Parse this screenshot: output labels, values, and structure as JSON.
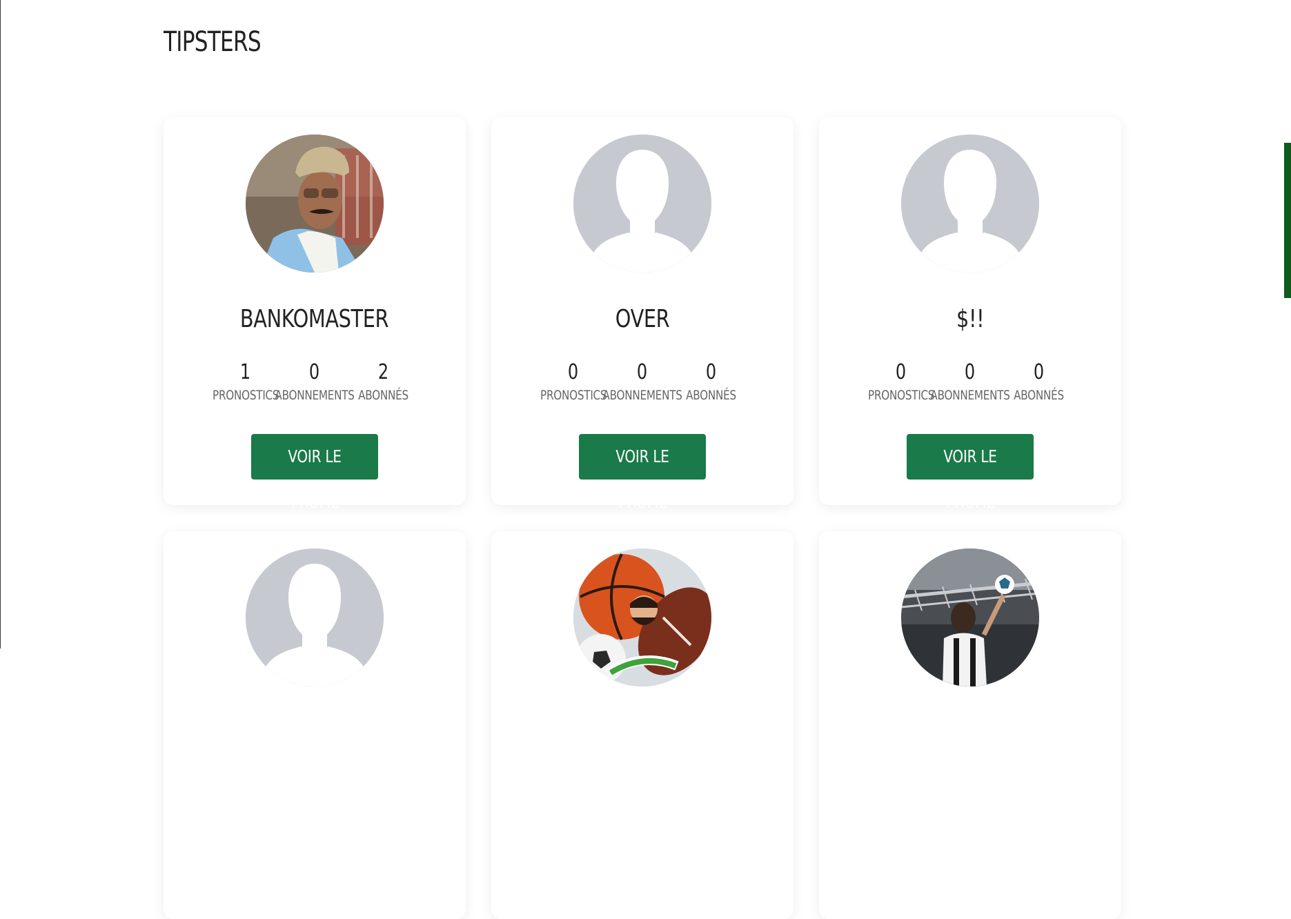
{
  "page": {
    "title": "TIPSTERS"
  },
  "colors": {
    "accent": "#1a7a49",
    "side_accent": "#0f5a1e",
    "avatar_placeholder": "#c6cad0"
  },
  "tipsters": [
    {
      "name": "BANKOMASTER",
      "avatar": "photo-man-cap-sunglasses",
      "stats": [
        {
          "value": "1",
          "label": "PRONOSTICS"
        },
        {
          "value": "0",
          "label": "ABONNEMENTS"
        },
        {
          "value": "2",
          "label": "ABONNÉS"
        }
      ],
      "button": "VOIR LE PROFIL"
    },
    {
      "name": "OVER",
      "avatar": "default-user-silhouette",
      "stats": [
        {
          "value": "0",
          "label": "PRONOSTICS"
        },
        {
          "value": "0",
          "label": "ABONNEMENTS"
        },
        {
          "value": "0",
          "label": "ABONNÉS"
        }
      ],
      "button": "VOIR LE PROFIL"
    },
    {
      "name": "$!!",
      "avatar": "default-user-silhouette",
      "stats": [
        {
          "value": "0",
          "label": "PRONOSTICS"
        },
        {
          "value": "0",
          "label": "ABONNEMENTS"
        },
        {
          "value": "0",
          "label": "ABONNÉS"
        }
      ],
      "button": "VOIR LE PROFIL"
    },
    {
      "avatar": "default-user-silhouette"
    },
    {
      "avatar": "money-sports-balls-logo"
    },
    {
      "avatar": "photo-footballer-stadium"
    }
  ]
}
